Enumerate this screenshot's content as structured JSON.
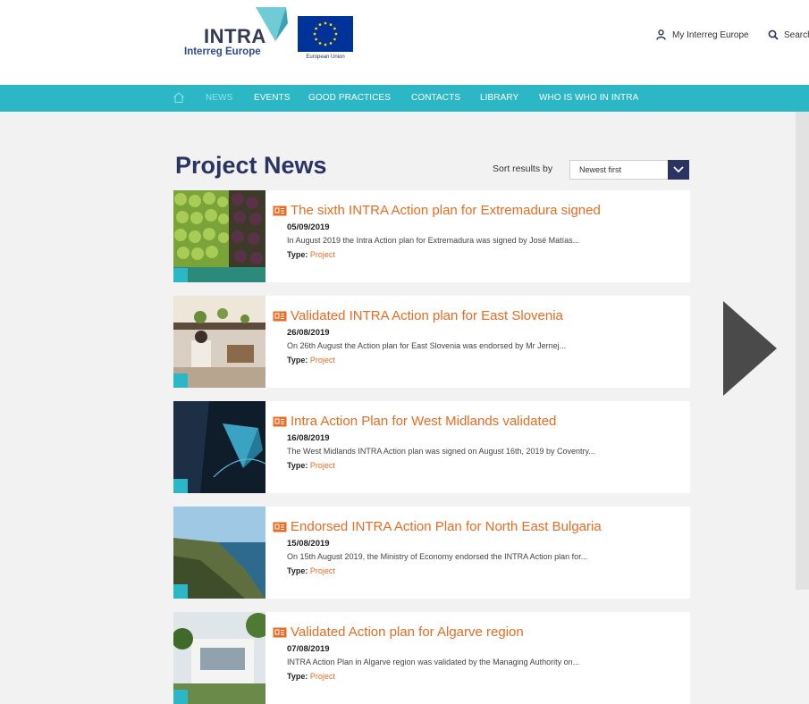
{
  "header": {
    "logo_title": "INTRA",
    "logo_subtitle": "Interreg Europe",
    "eu_label": "European Union",
    "my_interreg": "My Interreg Europe",
    "search": "Search",
    "brand_colors": {
      "navy": "#2a3463",
      "teal": "#2cb7c6",
      "orange": "#e86c23"
    }
  },
  "nav": {
    "home_icon": "home-icon",
    "items": [
      {
        "label": "NEWS",
        "active": true
      },
      {
        "label": "EVENTS"
      },
      {
        "label": "GOOD PRACTICES"
      },
      {
        "label": "CONTACTS"
      },
      {
        "label": "LIBRARY"
      },
      {
        "label": "WHO IS WHO IN INTRA"
      }
    ]
  },
  "main": {
    "title": "Project News",
    "sort_label": "Sort results by",
    "sort_value": "Newest first",
    "news": [
      {
        "title": "The sixth INTRA Action plan for Extremadura signed",
        "date": "05/09/2019",
        "excerpt": "In August 2019 the Intra Action plan for Extremadura was signed by José Matías...",
        "type_label": "Type:",
        "type_value": "Project"
      },
      {
        "title": "Validated INTRA Action plan for East Slovenia",
        "date": "26/08/2019",
        "excerpt": "On 26th August the Action plan for East Slovenia was endorsed by Mr Jernej...",
        "type_label": "Type:",
        "type_value": "Project"
      },
      {
        "title": "Intra Action Plan for West Midlands validated",
        "date": "16/08/2019",
        "excerpt": "The West Midlands INTRA Action plan was signed on August 16th, 2019 by Coventry...",
        "type_label": "Type:",
        "type_value": "Project"
      },
      {
        "title": "Endorsed INTRA Action Plan for North East Bulgaria",
        "date": "15/08/2019",
        "excerpt": "On 15th August 2019, the Ministry of Economy endorsed the INTRA Action plan for...",
        "type_label": "Type:",
        "type_value": "Project"
      },
      {
        "title": "Validated Action plan for Algarve region",
        "date": "07/08/2019",
        "excerpt": "INTRA Action Plan in Algarve region was validated by the Managing Authority on...",
        "type_label": "Type:",
        "type_value": "Project"
      }
    ]
  }
}
